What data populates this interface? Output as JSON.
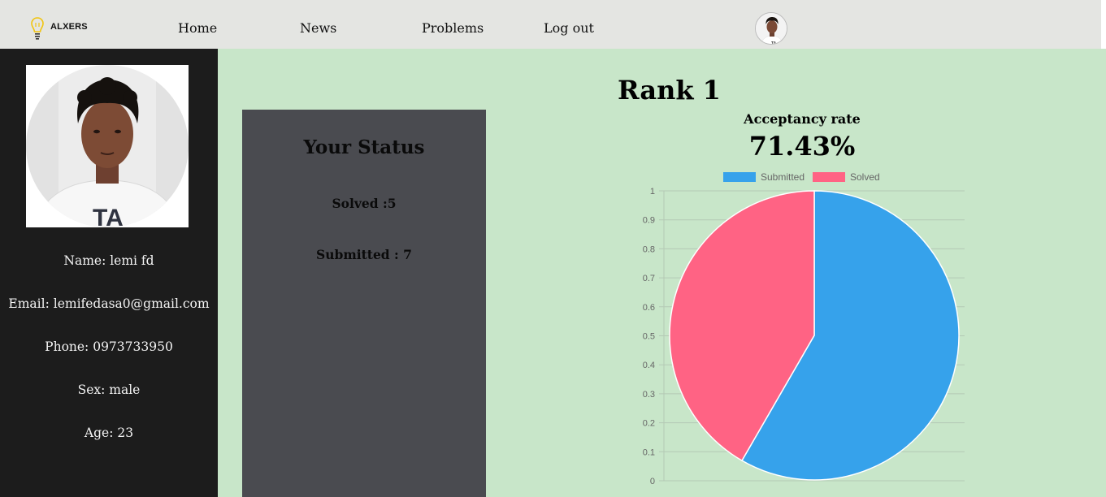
{
  "nav": {
    "logo_text": "ALXERS",
    "links": [
      "Home",
      "News",
      "Problems",
      "Log out"
    ]
  },
  "profile": {
    "name": "Name: lemi fd",
    "email": "Email: lemifedasa0@gmail.com",
    "phone": "Phone: 0973733950",
    "sex": "Sex: male",
    "age": "Age: 23"
  },
  "rank": "Rank 1",
  "status": {
    "title": "Your Status",
    "solved": "Solved :5",
    "submitted": "Submitted : 7"
  },
  "acceptancy": {
    "label": "Acceptancy rate",
    "value": "71.43%"
  },
  "colors": {
    "submitted": "#36a2eb",
    "solved": "#ff6384",
    "sidebar": "#1c1c1c",
    "status_panel": "#4a4b50",
    "background": "#c8e6c9",
    "navbar": "#e4e5e2"
  },
  "chart_data": {
    "type": "pie",
    "labels": [
      "Submitted",
      "Solved"
    ],
    "values": [
      7,
      5
    ],
    "colors": [
      "#36a2eb",
      "#ff6384"
    ],
    "legend": "top",
    "y_ticks": [
      "0",
      "0.1",
      "0.2",
      "0.3",
      "0.4",
      "0.5",
      "0.6",
      "0.7",
      "0.8",
      "0.9",
      "1"
    ],
    "grid": true
  }
}
